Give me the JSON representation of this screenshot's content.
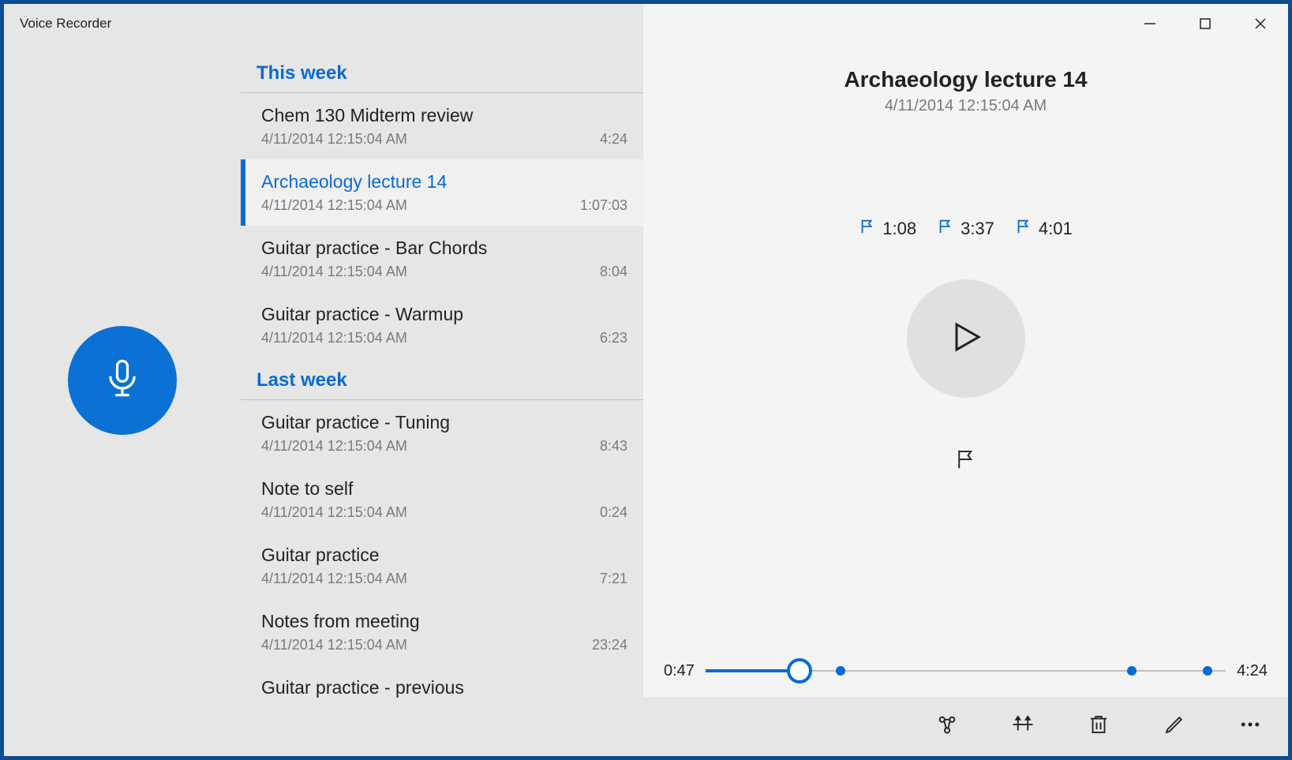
{
  "window": {
    "title": "Voice Recorder"
  },
  "colors": {
    "accent": "#0a6ad4",
    "border": "#0b4d8f"
  },
  "list": {
    "groups": [
      {
        "label": "This week",
        "items": [
          {
            "title": "Chem 130 Midterm review",
            "date": "4/11/2014 12:15:04 AM",
            "duration": "4:24",
            "selected": false
          },
          {
            "title": "Archaeology lecture 14",
            "date": "4/11/2014 12:15:04 AM",
            "duration": "1:07:03",
            "selected": true
          },
          {
            "title": "Guitar practice - Bar Chords",
            "date": "4/11/2014 12:15:04 AM",
            "duration": "8:04",
            "selected": false
          },
          {
            "title": "Guitar practice - Warmup",
            "date": "4/11/2014 12:15:04 AM",
            "duration": "6:23",
            "selected": false
          }
        ]
      },
      {
        "label": "Last week",
        "items": [
          {
            "title": "Guitar practice - Tuning",
            "date": "4/11/2014 12:15:04 AM",
            "duration": "8:43",
            "selected": false
          },
          {
            "title": "Note to self",
            "date": "4/11/2014 12:15:04 AM",
            "duration": "0:24",
            "selected": false
          },
          {
            "title": "Guitar practice",
            "date": "4/11/2014 12:15:04 AM",
            "duration": "7:21",
            "selected": false
          },
          {
            "title": "Notes from meeting",
            "date": "4/11/2014 12:15:04 AM",
            "duration": "23:24",
            "selected": false
          },
          {
            "title": "Guitar practice - previous",
            "date": "",
            "duration": "",
            "selected": false
          }
        ]
      }
    ]
  },
  "detail": {
    "title": "Archaeology lecture 14",
    "date": "4/11/2014 12:15:04 AM",
    "markers": [
      {
        "time": "1:08",
        "pos": 0.26
      },
      {
        "time": "3:37",
        "pos": 0.82
      },
      {
        "time": "4:01",
        "pos": 0.965
      }
    ],
    "playback": {
      "current": "0:47",
      "total": "4:24",
      "progress": 0.18
    }
  },
  "bottombar": {
    "share_icon": "share",
    "trim_icon": "trim",
    "delete_icon": "delete",
    "rename_icon": "rename",
    "more_icon": "more"
  }
}
